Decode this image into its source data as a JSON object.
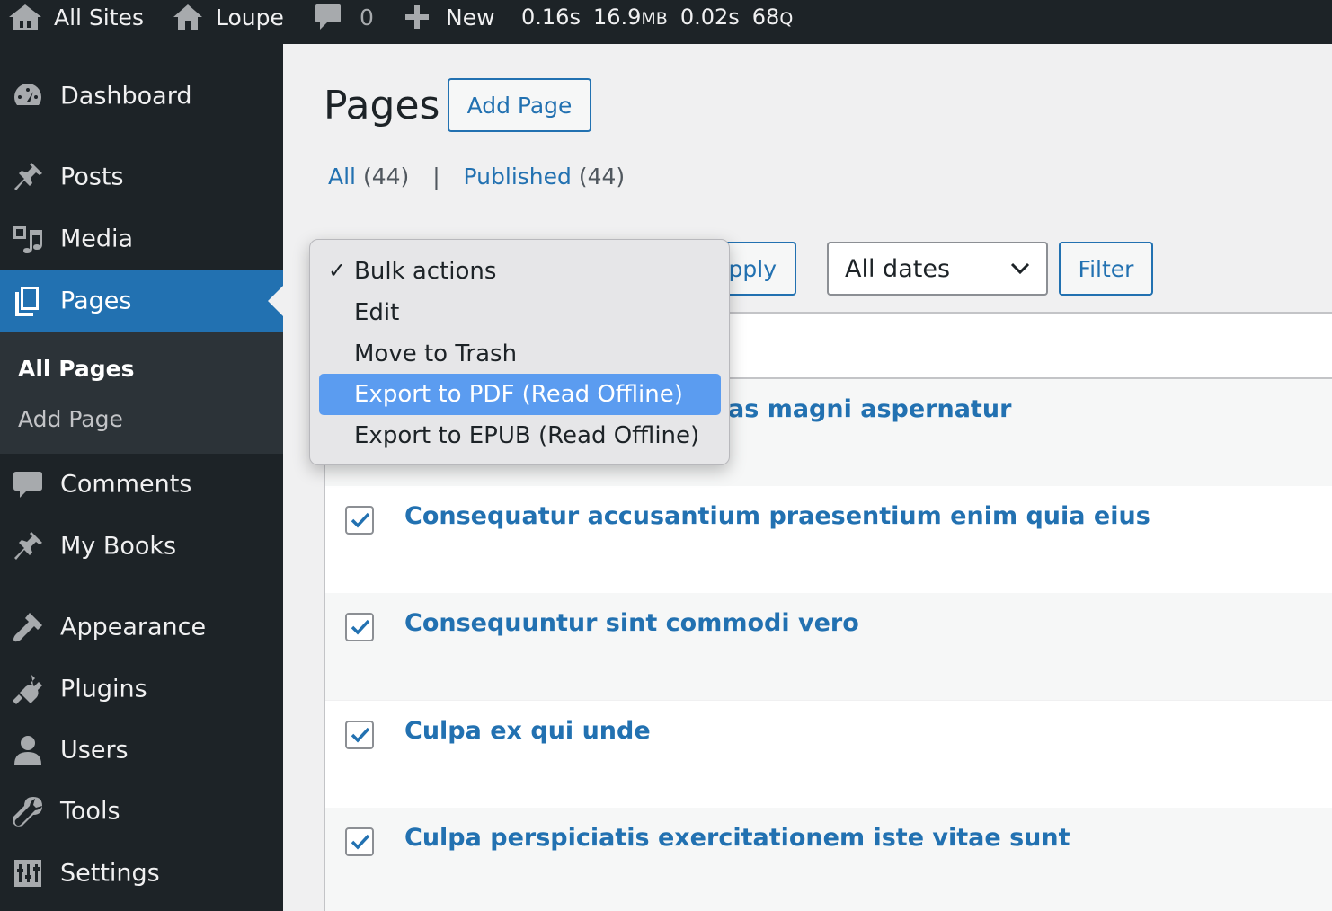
{
  "adminbar": {
    "all_sites": "All Sites",
    "site_name": "Loupe",
    "comments_count": "0",
    "new_label": "New",
    "stat_time": "0.16s",
    "stat_mem_num": "16.9",
    "stat_mem_unit": "MB",
    "stat_db_time": "0.02s",
    "stat_queries_num": "68",
    "stat_queries_unit": "Q"
  },
  "sidebar": {
    "items": [
      {
        "label": "Dashboard",
        "icon": "dashboard-icon"
      },
      {
        "label": "Posts",
        "icon": "pin-icon"
      },
      {
        "label": "Media",
        "icon": "media-icon"
      },
      {
        "label": "Pages",
        "icon": "pages-icon"
      },
      {
        "label": "Comments",
        "icon": "comment-icon"
      },
      {
        "label": "My Books",
        "icon": "pin-icon"
      },
      {
        "label": "Appearance",
        "icon": "brush-icon"
      },
      {
        "label": "Plugins",
        "icon": "plugin-icon"
      },
      {
        "label": "Users",
        "icon": "user-icon"
      },
      {
        "label": "Tools",
        "icon": "wrench-icon"
      },
      {
        "label": "Settings",
        "icon": "settings-icon"
      }
    ],
    "submenu": [
      "All Pages",
      "Add Page"
    ]
  },
  "main": {
    "title": "Pages",
    "add_page": "Add Page",
    "filters": {
      "all_label": "All",
      "all_count": "(44)",
      "separator": "|",
      "published_label": "Published",
      "published_count": "(44)"
    },
    "apply_label": "Apply",
    "dates_label": "All dates",
    "filter_label": "Filter"
  },
  "dropdown": {
    "options": [
      "Bulk actions",
      "Edit",
      "Move to Trash",
      "Export to PDF (Read Offline)",
      "Export to EPUB (Read Offline)"
    ],
    "selected": "Bulk actions",
    "highlighted": "Export to PDF (Read Offline)"
  },
  "rows": [
    {
      "title": "as magni aspernatur",
      "checked": true
    },
    {
      "title": "Consequatur accusantium praesentium enim quia eius",
      "checked": true
    },
    {
      "title": "Consequuntur sint commodi vero",
      "checked": true
    },
    {
      "title": "Culpa ex qui unde",
      "checked": true
    },
    {
      "title": "Culpa perspiciatis exercitationem iste vitae sunt",
      "checked": true
    }
  ],
  "colors": {
    "accent": "#2271b1",
    "adminbar_bg": "#1d2327",
    "highlight": "#5b9cf0"
  }
}
